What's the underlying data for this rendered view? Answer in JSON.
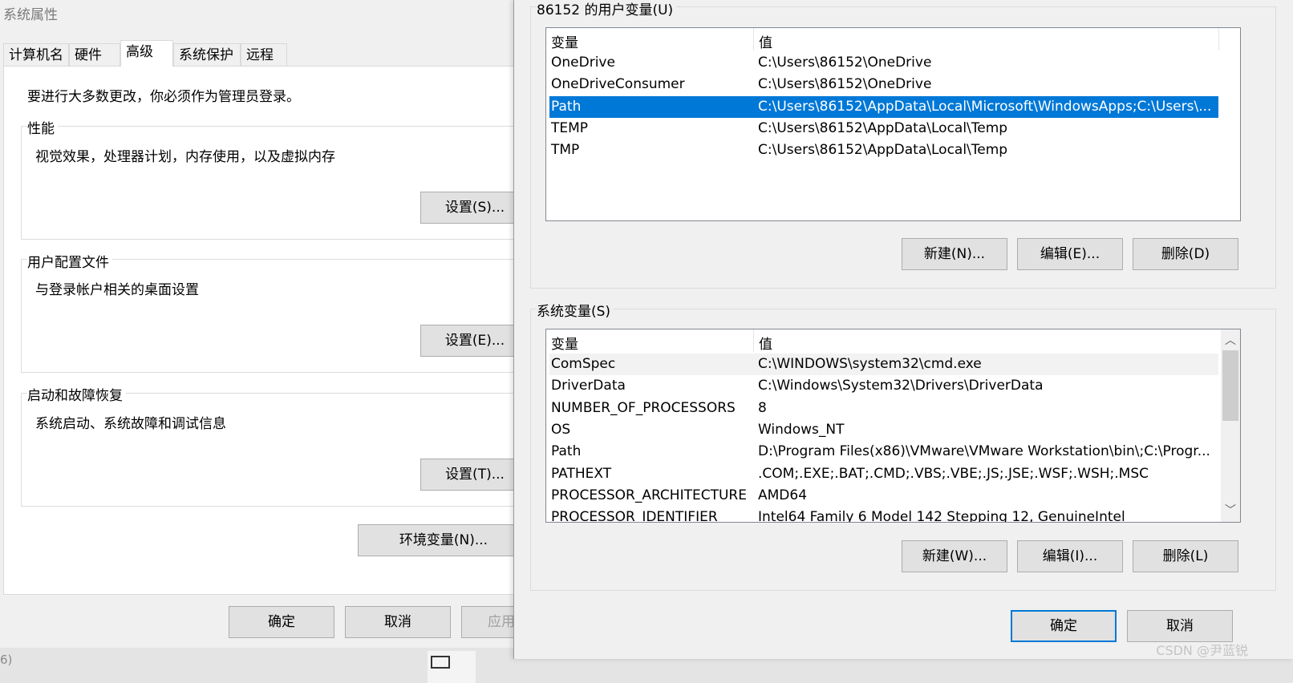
{
  "system_properties": {
    "title": "系统属性",
    "tabs": [
      "计算机名",
      "硬件",
      "高级",
      "系统保护",
      "远程"
    ],
    "active_tab": "高级",
    "admin_note": "要进行大多数更改，你必须作为管理员登录。",
    "performance": {
      "title": "性能",
      "description": "视觉效果，处理器计划，内存使用，以及虚拟内存",
      "button": "设置(S)..."
    },
    "user_profiles": {
      "title": "用户配置文件",
      "description": "与登录帐户相关的桌面设置",
      "button": "设置(E)..."
    },
    "startup_recovery": {
      "title": "启动和故障恢复",
      "description": "系统启动、系统故障和调试信息",
      "button": "设置(T)..."
    },
    "env_vars_button": "环境变量(N)...",
    "ok": "确定",
    "cancel": "取消",
    "apply": "应用"
  },
  "taskbar": {
    "left_text": "6)"
  },
  "environment_variables": {
    "user_section_label": "86152 的用户变量(U)",
    "system_section_label": "系统变量(S)",
    "col_variable": "变量",
    "col_value": "值",
    "user_vars": [
      {
        "name": "OneDrive",
        "value": "C:\\Users\\86152\\OneDrive"
      },
      {
        "name": "OneDriveConsumer",
        "value": "C:\\Users\\86152\\OneDrive"
      },
      {
        "name": "Path",
        "value": "C:\\Users\\86152\\AppData\\Local\\Microsoft\\WindowsApps;C:\\Users\\...",
        "selected": true
      },
      {
        "name": "TEMP",
        "value": "C:\\Users\\86152\\AppData\\Local\\Temp"
      },
      {
        "name": "TMP",
        "value": "C:\\Users\\86152\\AppData\\Local\\Temp"
      }
    ],
    "system_vars": [
      {
        "name": "ComSpec",
        "value": "C:\\WINDOWS\\system32\\cmd.exe"
      },
      {
        "name": "DriverData",
        "value": "C:\\Windows\\System32\\Drivers\\DriverData"
      },
      {
        "name": "NUMBER_OF_PROCESSORS",
        "value": "8"
      },
      {
        "name": "OS",
        "value": "Windows_NT"
      },
      {
        "name": "Path",
        "value": "D:\\Program Files(x86)\\VMware\\VMware Workstation\\bin\\;C:\\Progr..."
      },
      {
        "name": "PATHEXT",
        "value": ".COM;.EXE;.BAT;.CMD;.VBS;.VBE;.JS;.JSE;.WSF;.WSH;.MSC"
      },
      {
        "name": "PROCESSOR_ARCHITECTURE",
        "value": "AMD64"
      },
      {
        "name": "PROCESSOR_IDENTIFIER",
        "value": "Intel64 Family 6 Model 142 Stepping 12, GenuineIntel"
      }
    ],
    "user_buttons": {
      "new": "新建(N)...",
      "edit": "编辑(E)...",
      "delete": "删除(D)"
    },
    "system_buttons": {
      "new": "新建(W)...",
      "edit": "编辑(I)...",
      "delete": "删除(L)"
    },
    "ok": "确定",
    "cancel": "取消"
  },
  "watermark": "CSDN @尹蓝锐",
  "colors": {
    "selection": "#0078d7",
    "dialog_bg": "#f0f0f0",
    "button_bg": "#e1e1e1"
  }
}
